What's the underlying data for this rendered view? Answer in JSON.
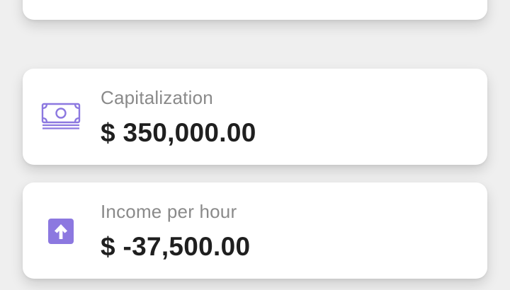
{
  "cards": [
    {
      "icon": "money-bill-icon",
      "label": "Capitalization",
      "value": "$ 350,000.00"
    },
    {
      "icon": "arrow-up-icon",
      "label": "Income per hour",
      "value": "$ -37,500.00"
    }
  ],
  "colors": {
    "accent": "#8c78e0",
    "background": "#efefef",
    "card": "#ffffff",
    "label": "#8a8a8a",
    "value": "#1f1f1f"
  }
}
